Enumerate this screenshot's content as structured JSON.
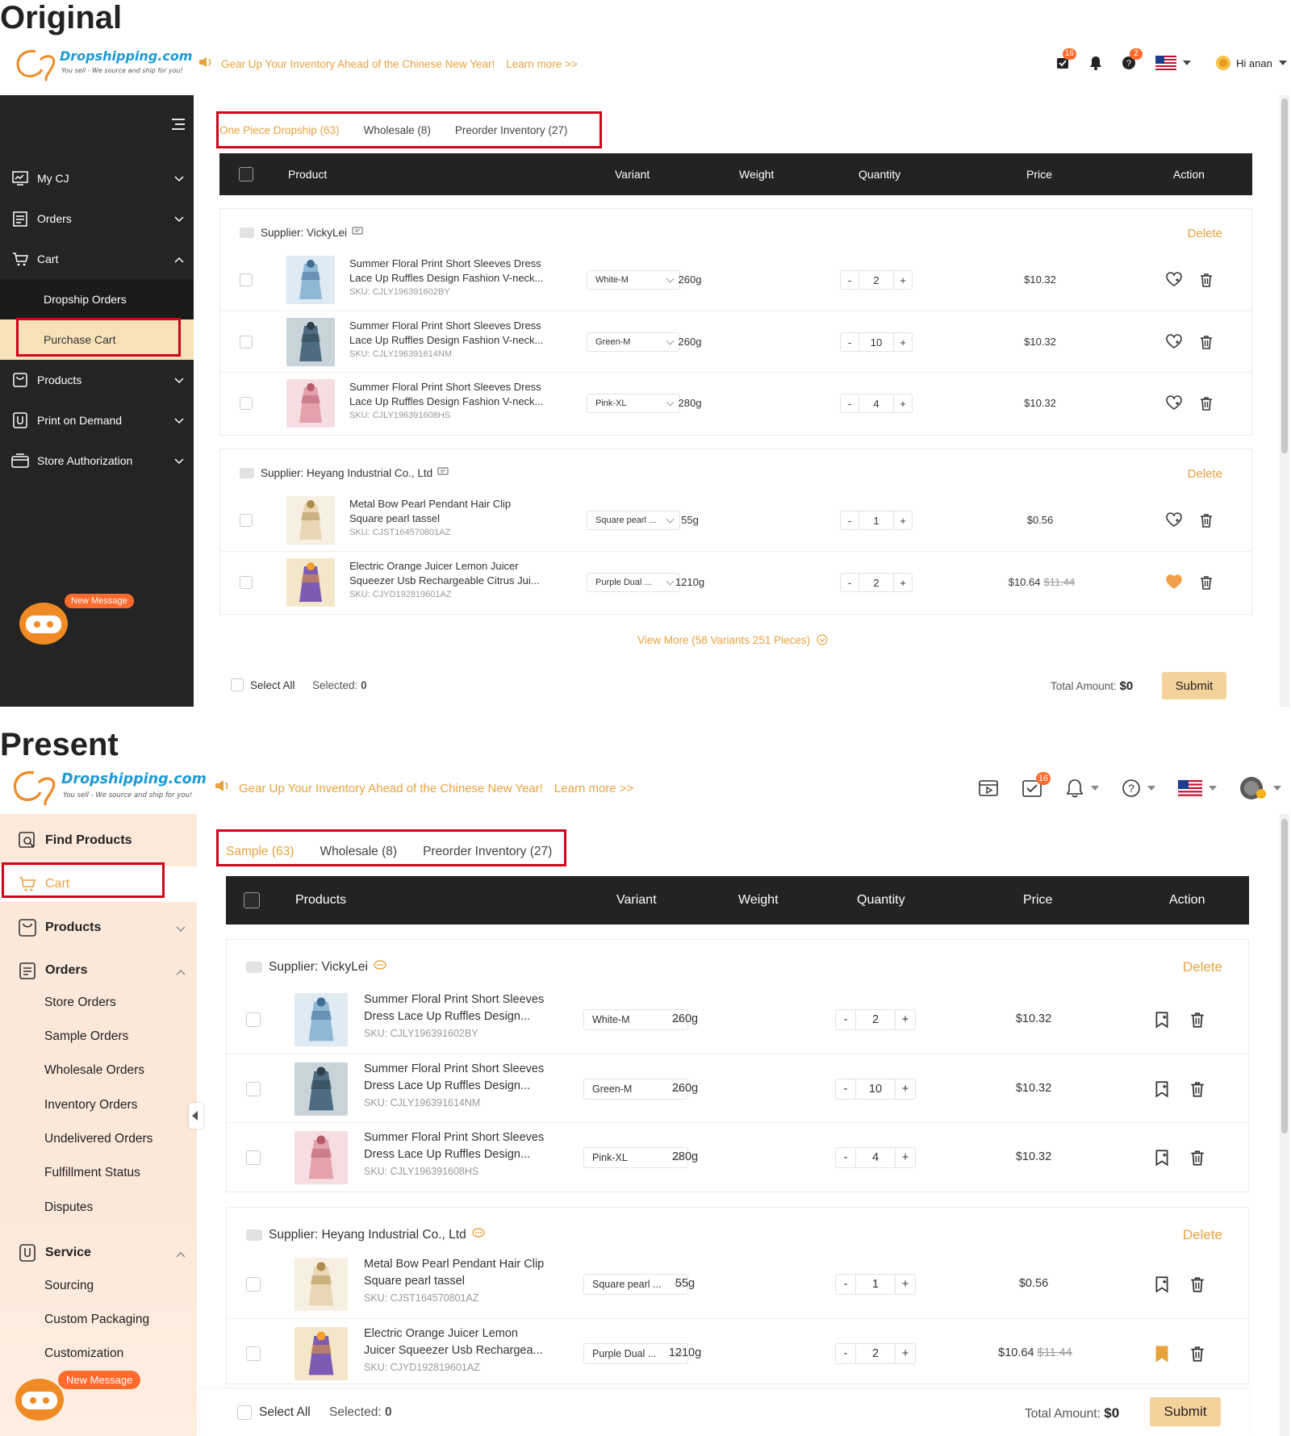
{
  "labels": {
    "original": "Original",
    "present": "Present"
  },
  "logo": {
    "name": "Dropshipping.com",
    "tagline": "You sell - We source and ship for you!"
  },
  "banner": {
    "text": "Gear Up Your Inventory Ahead of the Chinese New Year!",
    "learn_more": "Learn more >>"
  },
  "original": {
    "header": {
      "badge_orders": "16",
      "badge_help": "2",
      "greeting": "Hi anan"
    },
    "sidebar": {
      "items": [
        {
          "label": "My CJ",
          "icon": "dashboard-icon"
        },
        {
          "label": "Orders",
          "icon": "orders-icon"
        },
        {
          "label": "Cart",
          "icon": "cart-icon"
        }
      ],
      "sub_items": [
        "Dropship Orders",
        "Purchase Cart"
      ],
      "items2": [
        {
          "label": "Products",
          "icon": "products-icon"
        },
        {
          "label": "Print on Demand",
          "icon": "print-icon"
        },
        {
          "label": "Store Authorization",
          "icon": "store-icon"
        }
      ]
    },
    "tabs": [
      "One Piece Dropship (63)",
      "Wholesale (8)",
      "Preorder Inventory (27)"
    ],
    "columns": [
      "Product",
      "Variant",
      "Weight",
      "Quantity",
      "Price",
      "Action"
    ],
    "suppliers": [
      {
        "name": "Supplier: VickyLei",
        "delete": "Delete"
      },
      {
        "name": "Supplier: Heyang Industrial Co., Ltd",
        "delete": "Delete"
      }
    ],
    "rows": [
      {
        "line1": "Summer Floral Print Short Sleeves Dress",
        "line2": "Lace Up Ruffles Design Fashion V-neck...",
        "sku": "SKU: CJLY196391602BY",
        "variant": "White-M",
        "weight": "260g",
        "qty": "2",
        "price": "$10.32",
        "old_price": ""
      },
      {
        "line1": "Summer Floral Print Short Sleeves Dress",
        "line2": "Lace Up Ruffles Design Fashion V-neck...",
        "sku": "SKU: CJLY196391614NM",
        "variant": "Green-M",
        "weight": "260g",
        "qty": "10",
        "price": "$10.32",
        "old_price": ""
      },
      {
        "line1": "Summer Floral Print Short Sleeves Dress",
        "line2": "Lace Up Ruffles Design Fashion V-neck...",
        "sku": "SKU: CJLY196391608HS",
        "variant": "Pink-XL",
        "weight": "280g",
        "qty": "4",
        "price": "$10.32",
        "old_price": ""
      },
      {
        "line1": "Metal Bow Pearl Pendant Hair Clip",
        "line2": "Square pearl tassel",
        "sku": "SKU: CJST164570801AZ",
        "variant": "Square pearl ...",
        "weight": "55g",
        "qty": "1",
        "price": "$0.56",
        "old_price": ""
      },
      {
        "line1": "Electric Orange Juicer Lemon Juicer",
        "line2": "Squeezer Usb Rechargeable Citrus Jui...",
        "sku": "SKU: CJYD192819601AZ",
        "variant": "Purple Dual ...",
        "weight": "1210g",
        "qty": "2",
        "price": "$10.64",
        "old_price": "$11.44"
      }
    ],
    "view_more": "View More (58 Variants 251 Pieces)",
    "footer": {
      "select_all": "Select All",
      "selected_label": "Selected:",
      "selected_value": "0",
      "total_label": "Total Amount:",
      "total_value": "$0",
      "submit": "Submit"
    },
    "new_message": "New Message"
  },
  "present": {
    "header": {
      "badge_orders": "16"
    },
    "sidebar": {
      "find_products": "Find Products",
      "cart": "Cart",
      "products": "Products",
      "orders": "Orders",
      "order_subs": [
        "Store Orders",
        "Sample Orders",
        "Wholesale Orders",
        "Inventory Orders",
        "Undelivered Orders",
        "Fulfillment Status",
        "Disputes"
      ],
      "service": "Service",
      "service_subs": [
        "Sourcing",
        "Custom Packaging",
        "Customization"
      ]
    },
    "tabs": [
      "Sample (63)",
      "Wholesale (8)",
      "Preorder Inventory (27)"
    ],
    "columns": [
      "Products",
      "Variant",
      "Weight",
      "Quantity",
      "Price",
      "Action"
    ],
    "suppliers": [
      {
        "name": "Supplier: VickyLei",
        "delete": "Delete"
      },
      {
        "name": "Supplier: Heyang Industrial Co., Ltd",
        "delete": "Delete"
      }
    ],
    "rows": [
      {
        "line1": "Summer Floral Print Short Sleeves",
        "line2": "Dress Lace Up Ruffles Design...",
        "sku": "SKU: CJLY196391602BY",
        "variant": "White-M",
        "weight": "260g",
        "qty": "2",
        "price": "$10.32",
        "old_price": ""
      },
      {
        "line1": "Summer Floral Print Short Sleeves",
        "line2": "Dress Lace Up Ruffles Design...",
        "sku": "SKU: CJLY196391614NM",
        "variant": "Green-M",
        "weight": "260g",
        "qty": "10",
        "price": "$10.32",
        "old_price": ""
      },
      {
        "line1": "Summer Floral Print Short Sleeves",
        "line2": "Dress Lace Up Ruffles Design...",
        "sku": "SKU: CJLY196391608HS",
        "variant": "Pink-XL",
        "weight": "280g",
        "qty": "4",
        "price": "$10.32",
        "old_price": ""
      },
      {
        "line1": "Metal Bow Pearl Pendant Hair Clip",
        "line2": "Square pearl tassel",
        "sku": "SKU: CJST164570801AZ",
        "variant": "Square pearl ...",
        "weight": "55g",
        "qty": "1",
        "price": "$0.56",
        "old_price": ""
      },
      {
        "line1": "Electric Orange Juicer Lemon",
        "line2": "Juicer Squeezer Usb Rechargea...",
        "sku": "SKU: CJYD192819601AZ",
        "variant": "Purple Dual ...",
        "weight": "1210g",
        "qty": "2",
        "price": "$10.64",
        "old_price": "$11.44"
      }
    ],
    "footer": {
      "select_all": "Select All",
      "selected_label": "Selected:",
      "selected_value": "0",
      "total_label": "Total Amount:",
      "total_value": "$0",
      "submit": "Submit"
    },
    "new_message": "New Message"
  },
  "colors": {
    "accent": "#e8a23d",
    "highlight_border": "#d0021b",
    "sidebar_dark": "#242424",
    "table_header": "#232323",
    "badge": "#ff6a2d"
  }
}
